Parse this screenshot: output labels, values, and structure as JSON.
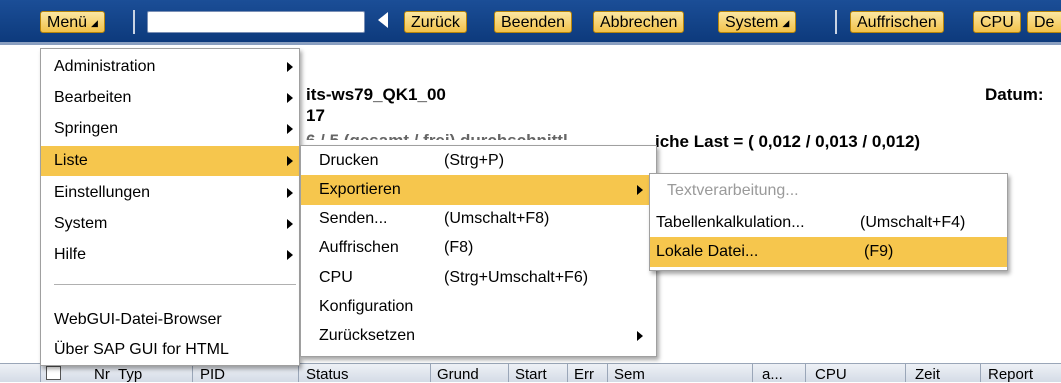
{
  "toolbar": {
    "menu_label": "Menü",
    "command_value": "",
    "back_label": "Zurück",
    "exit_label": "Beenden",
    "cancel_label": "Abbrechen",
    "system_label": "System",
    "refresh_label": "Auffrischen",
    "cpu_label": "CPU",
    "cut_label": "De"
  },
  "content": {
    "host": "its-ws79_QK1_00",
    "date_label": "Datum:",
    "line2": "17",
    "line3_left": "6 / 5 (gesamt / frei)  durchschnittl",
    "line3_right": "iche Last = ( 0,012 / 0,013 / 0,012)"
  },
  "main_menu": {
    "items": [
      "Administration",
      "Bearbeiten",
      "Springen",
      "Liste",
      "Einstellungen",
      "System",
      "Hilfe"
    ],
    "extra_items": [
      "WebGUI-Datei-Browser",
      "Über SAP GUI for HTML"
    ]
  },
  "liste_menu": {
    "items": [
      {
        "label": "Drucken",
        "shortcut": "(Strg+P)"
      },
      {
        "label": "Exportieren",
        "shortcut": ""
      },
      {
        "label": "Senden...",
        "shortcut": "(Umschalt+F8)"
      },
      {
        "label": "Auffrischen",
        "shortcut": "(F8)"
      },
      {
        "label": "CPU",
        "shortcut": "(Strg+Umschalt+F6)"
      },
      {
        "label": "Konfiguration",
        "shortcut": ""
      },
      {
        "label": "Zurücksetzen",
        "shortcut": ""
      }
    ]
  },
  "export_menu": {
    "items": [
      {
        "label": "Textverarbeitung...",
        "shortcut": ""
      },
      {
        "label": "Tabellenkalkulation...",
        "shortcut": "(Umschalt+F4)"
      },
      {
        "label": "Lokale Datei...",
        "shortcut": "(F9)"
      }
    ]
  },
  "table": {
    "columns": [
      "Nr",
      "Typ",
      "PID",
      "Status",
      "Grund",
      "Start",
      "Err",
      "Sem",
      "a...",
      "CPU",
      "Zeit",
      "Report"
    ]
  },
  "colors": {
    "toolbar_bg": "#0d3a7c",
    "button_bg": "#f2c14a",
    "menu_highlight": "#f6c64d"
  }
}
